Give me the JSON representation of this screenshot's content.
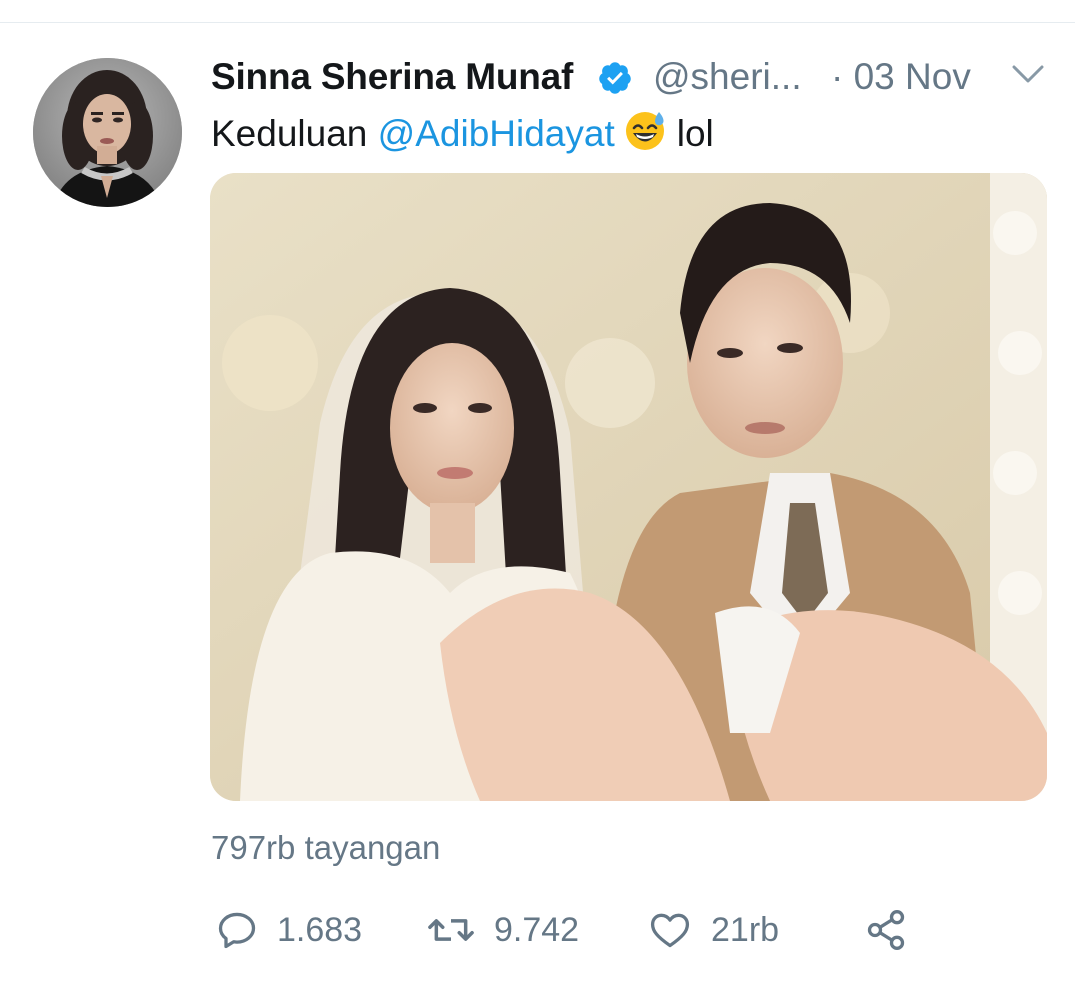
{
  "tweet": {
    "author_name": "Sinna Sherina Munaf",
    "handle": "@sheri...",
    "date": "· 03 Nov",
    "text_before": "Keduluan ",
    "mention": "@AdibHidayat",
    "emoji": "grinning-face-with-sweat",
    "text_after": "lol",
    "views": "797rb tayangan"
  },
  "actions": {
    "reply_count": "1.683",
    "retweet_count": "9.742",
    "like_count": "21rb"
  },
  "colors": {
    "text": "#14171a",
    "secondary": "#657786",
    "link": "#1b95e0",
    "verified": "#1da1f2"
  }
}
